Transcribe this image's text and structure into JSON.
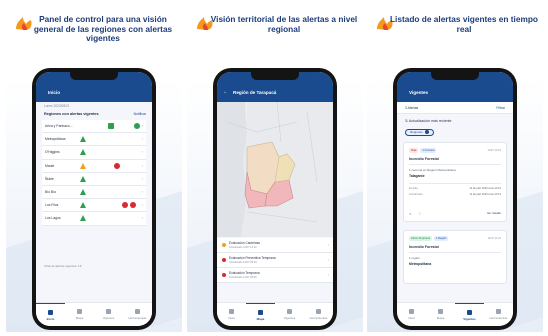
{
  "colors": {
    "brand_blue": "#1a4b8f",
    "caption_blue": "#1d3d7a",
    "alert_red": "#d9282f",
    "alert_amber": "#f0a020",
    "alert_green": "#2e9e4f",
    "logo_orange": "#f39a1e",
    "logo_red": "#e8452c"
  },
  "panels": [
    {
      "caption": "Panel de control para una visión general de las regiones con alertas vigentes"
    },
    {
      "caption": "Visión territorial de las alertas a nivel regional"
    },
    {
      "caption": "Listado de alertas vigentes en tiempo real"
    }
  ],
  "screen1": {
    "title": "Inicio",
    "subtitle": "Lunes 2023/08/21",
    "section_title": "Regiones con alertas vigentes",
    "section_action": "Notificar",
    "regions": [
      {
        "name": "Arica y Parinaco..."
      },
      {
        "name": "Metropolitana"
      },
      {
        "name": "O'Higgins"
      },
      {
        "name": "Maule"
      },
      {
        "name": "Ñuble"
      },
      {
        "name": "Bío Bío"
      },
      {
        "name": "Los Ríos"
      },
      {
        "name": "Los Lagos"
      }
    ],
    "footer": "Total de alertas vigentes: 19"
  },
  "screen2": {
    "title": "Región de Tarapacá",
    "alerts": [
      {
        "title": "Evaluación Cautelosa",
        "sub": "Actualizado 11/07 14:22",
        "level": "amber"
      },
      {
        "title": "Evaluación Preventiva Temprana",
        "sub": "Actualizado 11/07 09:16",
        "level": "red"
      },
      {
        "title": "Evaluación Temprana",
        "sub": "Actualizado 11/07 08:05",
        "level": "red"
      }
    ]
  },
  "screen3": {
    "title": "Vigentes",
    "count": "3 Alertas",
    "action": "Filtrar",
    "sort_label": "Actualización más reciente",
    "filter_chip": "Regiones",
    "card1": {
      "badge1": "Roja",
      "badge2": "1 Comuna",
      "date": "11/07 13:13",
      "type": "Incendio Forestal",
      "line": "1 comuna en Región Metropolitana",
      "place": "Talagante",
      "k1": "Emitida",
      "v1": "11 de julio 2023 a las 13:12",
      "k2": "Actualizada",
      "v2": "11 de julio 2023 a las 13:13",
      "more": "Ver detalle"
    },
    "card2": {
      "badge1": "Alerta Temprana",
      "badge2": "1 Región",
      "date": "11/07 11:21",
      "type": "Incendio Forestal",
      "line": "1 región",
      "place": "Metropolitana"
    }
  },
  "nav": {
    "home": "Inicio",
    "map": "Mapa",
    "alerts": "Vigentes",
    "more": "Herramientas"
  }
}
